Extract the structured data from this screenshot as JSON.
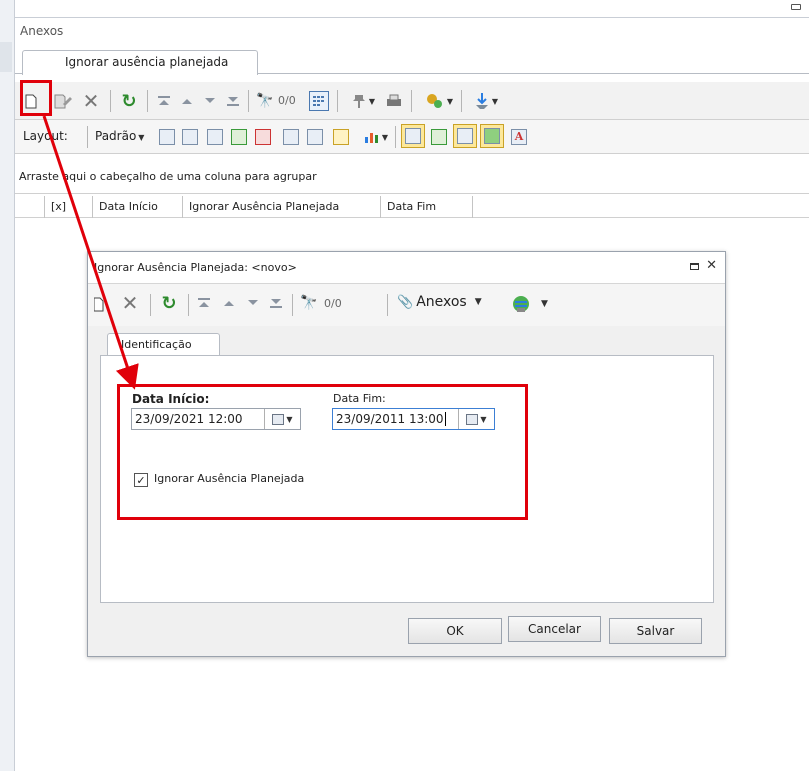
{
  "window": {
    "section_title": "Anexos",
    "tab_label": "Ignorar ausência planejada"
  },
  "toolbar1": {
    "record_counter": "0/0"
  },
  "toolbar2": {
    "layout_label": "Layout:",
    "layout_value": "Padrão"
  },
  "grid": {
    "group_hint": "Arraste aqui o cabeçalho de uma coluna para agrupar",
    "columns": [
      "[x]",
      "Data Início",
      "Ignorar Ausência Planejada",
      "Data Fim"
    ]
  },
  "dialog": {
    "title": "Ignorar Ausência Planejada: <novo>",
    "record_counter": "0/0",
    "anexos_label": "Anexos",
    "tab_label": "Identificação",
    "data_inicio_label": "Data Início:",
    "data_inicio_value": "23/09/2021 12:00",
    "data_fim_label": "Data Fim:",
    "data_fim_value": "23/09/2011 13:00",
    "checkbox_label": "Ignorar Ausência Planejada",
    "checkbox_checked": true,
    "ok_label": "OK",
    "cancel_label": "Cancelar",
    "save_label": "Salvar"
  },
  "colors": {
    "highlight": "#e0000a",
    "refresh_green": "#2e8b2e"
  }
}
